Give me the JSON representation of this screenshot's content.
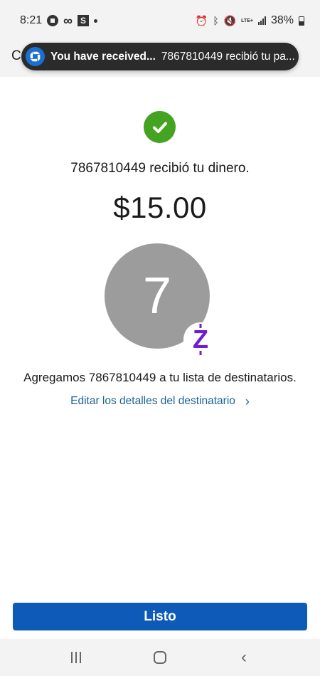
{
  "status_bar": {
    "time": "8:21",
    "network": "LTE+",
    "battery": "38%"
  },
  "header": {
    "title_initial": "C"
  },
  "notification": {
    "title": "You have received...",
    "body": "7867810449 recibió tu pa..."
  },
  "main": {
    "received_message": "7867810449 recibió tu dinero.",
    "amount": "$15.00",
    "avatar_initial": "7",
    "badge_symbol": "Z",
    "added_message": "Agregamos 7867810449 a tu lista de destinatarios.",
    "edit_link": "Editar los detalles del destinatario"
  },
  "done_button": {
    "label": "Listo"
  },
  "colors": {
    "success": "#44a320",
    "primary_button": "#0e5ab8",
    "link": "#1a6494",
    "zelle": "#6d1ed4",
    "avatar": "#9c9c9c"
  }
}
